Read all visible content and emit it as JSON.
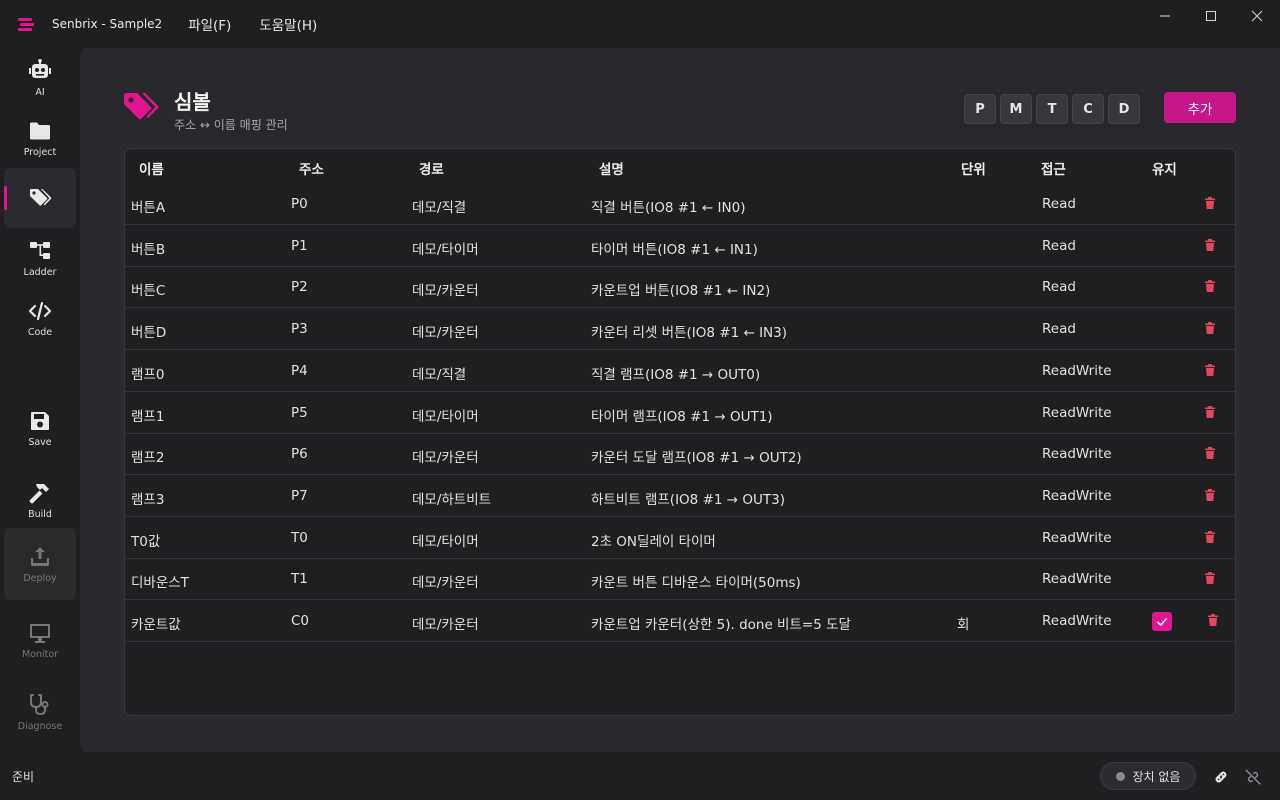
{
  "app": {
    "title": "Senbrix - Sample2"
  },
  "menu": [
    {
      "label": "파일(F)"
    },
    {
      "label": "도움말(H)"
    }
  ],
  "sidebar": {
    "items": [
      {
        "label": "AI",
        "icon": "robot-icon"
      },
      {
        "label": "Project",
        "icon": "folder-icon"
      },
      {
        "label": "",
        "icon": "tags-icon",
        "active": true
      },
      {
        "label": "Ladder",
        "icon": "ladder-icon"
      },
      {
        "label": "Code",
        "icon": "code-icon"
      },
      {
        "label": "Save",
        "icon": "save-icon"
      },
      {
        "label": "Build",
        "icon": "hammer-icon"
      },
      {
        "label": "Deploy",
        "icon": "upload-icon",
        "disabled": true
      },
      {
        "label": "Monitor",
        "icon": "monitor-icon",
        "disabled": true
      },
      {
        "label": "Diagnose",
        "icon": "stethoscope-icon",
        "disabled": true
      }
    ]
  },
  "header": {
    "title": "심볼",
    "subtitle": "주소 ↔ 이름 매핑 관리",
    "filters": [
      "P",
      "M",
      "T",
      "C",
      "D"
    ],
    "add_label": "추가"
  },
  "table": {
    "columns": [
      "이름",
      "주소",
      "경로",
      "설명",
      "단위",
      "접근",
      "유지"
    ],
    "rows": [
      {
        "name": "버튼A",
        "address": "P0",
        "path": "데모/직결",
        "description": "직결 버튼(IO8 #1 ← IN0)",
        "unit": "",
        "access": "Read",
        "retain": false
      },
      {
        "name": "버튼B",
        "address": "P1",
        "path": "데모/타이머",
        "description": "타이머 버튼(IO8 #1 ← IN1)",
        "unit": "",
        "access": "Read",
        "retain": false
      },
      {
        "name": "버튼C",
        "address": "P2",
        "path": "데모/카운터",
        "description": "카운트업 버튼(IO8 #1 ← IN2)",
        "unit": "",
        "access": "Read",
        "retain": false
      },
      {
        "name": "버튼D",
        "address": "P3",
        "path": "데모/카운터",
        "description": "카운터 리셋 버튼(IO8 #1 ← IN3)",
        "unit": "",
        "access": "Read",
        "retain": false
      },
      {
        "name": "램프0",
        "address": "P4",
        "path": "데모/직결",
        "description": "직결 램프(IO8 #1 → OUT0)",
        "unit": "",
        "access": "ReadWrite",
        "retain": false
      },
      {
        "name": "램프1",
        "address": "P5",
        "path": "데모/타이머",
        "description": "타이머 램프(IO8 #1 → OUT1)",
        "unit": "",
        "access": "ReadWrite",
        "retain": false
      },
      {
        "name": "램프2",
        "address": "P6",
        "path": "데모/카운터",
        "description": "카운터 도달 램프(IO8 #1 → OUT2)",
        "unit": "",
        "access": "ReadWrite",
        "retain": false
      },
      {
        "name": "램프3",
        "address": "P7",
        "path": "데모/하트비트",
        "description": "하트비트 램프(IO8 #1 → OUT3)",
        "unit": "",
        "access": "ReadWrite",
        "retain": false
      },
      {
        "name": "T0값",
        "address": "T0",
        "path": "데모/타이머",
        "description": "2초 ON딜레이 타이머",
        "unit": "",
        "access": "ReadWrite",
        "retain": false
      },
      {
        "name": "디바운스T",
        "address": "T1",
        "path": "데모/카운터",
        "description": "카운트 버튼 디바운스 타이머(50ms)",
        "unit": "",
        "access": "ReadWrite",
        "retain": false
      },
      {
        "name": "카운트값",
        "address": "C0",
        "path": "데모/카운터",
        "description": "카운트업 카운터(상한 5). done 비트=5 도달",
        "unit": "회",
        "access": "ReadWrite",
        "retain": true
      }
    ]
  },
  "status": {
    "text": "준비",
    "device": "장치 없음"
  },
  "colors": {
    "accent": "#e0158f",
    "button": "#c7168a",
    "danger": "#e0485f",
    "panel": "#29292d",
    "background": "#1f1f22"
  }
}
